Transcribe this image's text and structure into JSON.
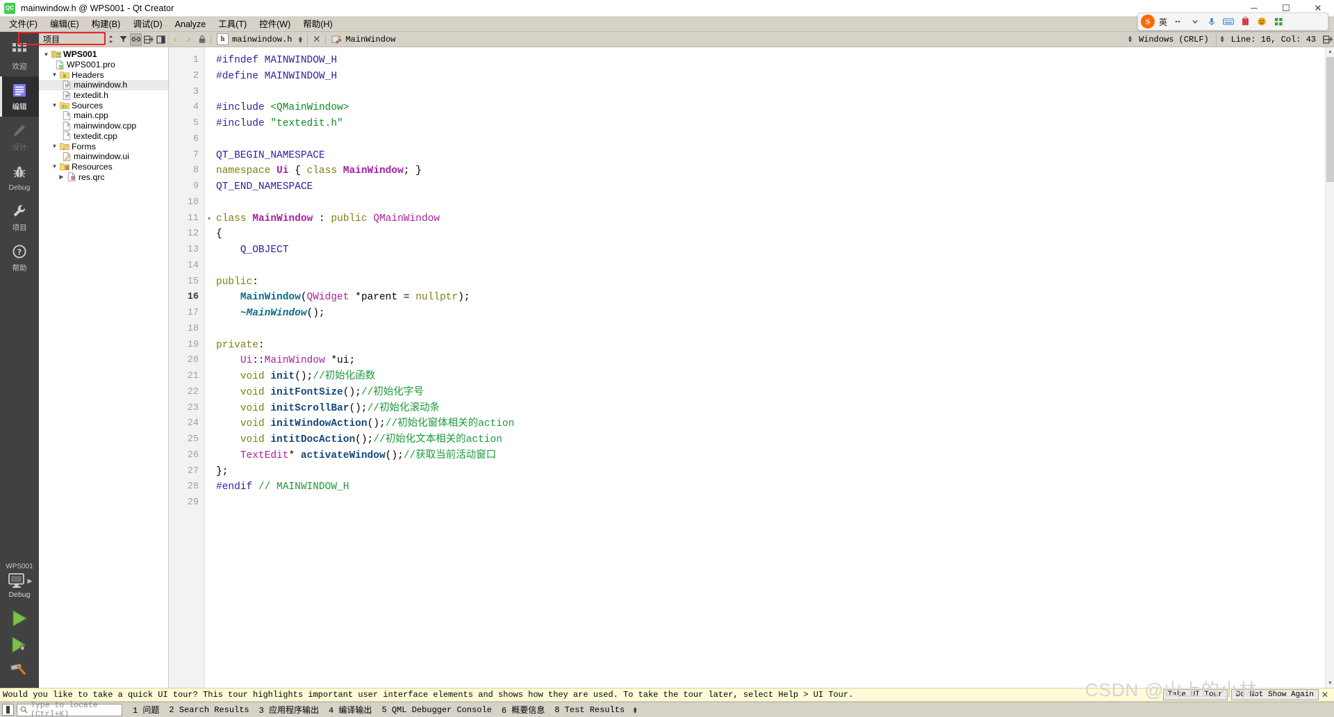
{
  "window": {
    "title": "mainwindow.h @ WPS001 - Qt Creator",
    "app_icon": "qt-creator-icon",
    "minimize": "─",
    "maximize": "☐",
    "close": "✕"
  },
  "menubar": {
    "items": [
      {
        "label": "文件(F)",
        "name": "menu-file"
      },
      {
        "label": "编辑(E)",
        "name": "menu-edit"
      },
      {
        "label": "构建(B)",
        "name": "menu-build"
      },
      {
        "label": "调试(D)",
        "name": "menu-debug"
      },
      {
        "label": "Analyze",
        "name": "menu-analyze"
      },
      {
        "label": "工具(T)",
        "name": "menu-tools"
      },
      {
        "label": "控件(W)",
        "name": "menu-window"
      },
      {
        "label": "帮助(H)",
        "name": "menu-help"
      }
    ]
  },
  "ime_toolbar": {
    "logo": "S",
    "mode_label": "英",
    "items": [
      "dots-icon",
      "chevron-down-icon",
      "microphone-icon",
      "keyboard-icon",
      "clipboard-icon",
      "emoji-icon",
      "grid-icon"
    ]
  },
  "modebar": {
    "items": [
      {
        "label": "欢迎",
        "icon": "grid-icon",
        "state": "normal",
        "name": "mode-welcome"
      },
      {
        "label": "编辑",
        "icon": "document-icon",
        "state": "active",
        "name": "mode-edit"
      },
      {
        "label": "设计",
        "icon": "pencil-icon",
        "state": "disabled",
        "name": "mode-design"
      },
      {
        "label": "Debug",
        "icon": "bug-icon",
        "state": "normal",
        "name": "mode-debug"
      },
      {
        "label": "项目",
        "icon": "wrench-icon",
        "state": "normal",
        "name": "mode-projects"
      },
      {
        "label": "帮助",
        "icon": "question-icon",
        "state": "normal",
        "name": "mode-help"
      }
    ],
    "kit": {
      "project": "WPS001",
      "build_config": "Debug",
      "icon": "computer-icon",
      "run_tooltip": "run-button",
      "debug_tooltip": "start-debugging-button",
      "build_tooltip": "build-button"
    }
  },
  "project_pane": {
    "title": "项目",
    "toolbar": [
      "sync-view-icon",
      "filter-icon",
      "link-icon",
      "split-icon",
      "close-split-icon"
    ],
    "tree": [
      {
        "depth": 0,
        "twisty": "▼",
        "icon": "qt-project-icon",
        "label": "WPS001",
        "bold": true,
        "name": "tree-item-project"
      },
      {
        "depth": 1,
        "twisty": "",
        "icon": "pro-file-icon",
        "label": "WPS001.pro",
        "bold": false,
        "name": "tree-item-pro-file"
      },
      {
        "depth": 1,
        "twisty": "▼",
        "icon": "headers-folder-icon",
        "label": "Headers",
        "bold": false,
        "name": "tree-item-headers"
      },
      {
        "depth": 2,
        "twisty": "",
        "icon": "h-file-icon",
        "label": "mainwindow.h",
        "bold": false,
        "selected": true,
        "highlight": true,
        "name": "tree-item-mainwindow-h"
      },
      {
        "depth": 2,
        "twisty": "",
        "icon": "h-file-icon",
        "label": "textedit.h",
        "bold": false,
        "name": "tree-item-textedit-h"
      },
      {
        "depth": 1,
        "twisty": "▼",
        "icon": "sources-folder-icon",
        "label": "Sources",
        "bold": false,
        "name": "tree-item-sources"
      },
      {
        "depth": 2,
        "twisty": "",
        "icon": "cpp-file-icon",
        "label": "main.cpp",
        "bold": false,
        "name": "tree-item-main-cpp"
      },
      {
        "depth": 2,
        "twisty": "",
        "icon": "cpp-file-icon",
        "label": "mainwindow.cpp",
        "bold": false,
        "name": "tree-item-mainwindow-cpp"
      },
      {
        "depth": 2,
        "twisty": "",
        "icon": "cpp-file-icon",
        "label": "textedit.cpp",
        "bold": false,
        "name": "tree-item-textedit-cpp"
      },
      {
        "depth": 1,
        "twisty": "▼",
        "icon": "forms-folder-icon",
        "label": "Forms",
        "bold": false,
        "name": "tree-item-forms"
      },
      {
        "depth": 2,
        "twisty": "",
        "icon": "ui-file-icon",
        "label": "mainwindow.ui",
        "bold": false,
        "name": "tree-item-mainwindow-ui"
      },
      {
        "depth": 1,
        "twisty": "▼",
        "icon": "resources-folder-icon",
        "label": "Resources",
        "bold": false,
        "name": "tree-item-resources"
      },
      {
        "depth": 2,
        "twisty": "▶",
        "icon": "qrc-file-icon",
        "label": "res.qrc",
        "bold": false,
        "name": "tree-item-res-qrc"
      }
    ]
  },
  "editor": {
    "toolbar": {
      "back": "‹",
      "forward": "›",
      "lock": "lock-icon",
      "file_badge": "h",
      "file_name": "mainwindow.h",
      "file_dropdown": "↕",
      "close": "✕",
      "symbol_icon": "class-icon",
      "symbol_name": "MainWindow"
    },
    "status": {
      "line_ending": "Windows (CRLF)",
      "cursor": "Line: 16, Col: 43",
      "split_icon": "split-editor-icon"
    },
    "current_line": 16,
    "total_lines": 29,
    "lines": [
      {
        "n": 1,
        "fold": "",
        "tokens": [
          {
            "t": "#ifndef MAINWINDOW_H",
            "c": "t-pp"
          }
        ]
      },
      {
        "n": 2,
        "fold": "",
        "tokens": [
          {
            "t": "#define MAINWINDOW_H",
            "c": "t-pp"
          }
        ]
      },
      {
        "n": 3,
        "fold": "",
        "tokens": []
      },
      {
        "n": 4,
        "fold": "",
        "tokens": [
          {
            "t": "#include ",
            "c": "t-pp"
          },
          {
            "t": "<QMainWindow>",
            "c": "t-str"
          }
        ]
      },
      {
        "n": 5,
        "fold": "",
        "tokens": [
          {
            "t": "#include ",
            "c": "t-pp"
          },
          {
            "t": "\"textedit.h\"",
            "c": "t-str"
          }
        ]
      },
      {
        "n": 6,
        "fold": "",
        "tokens": []
      },
      {
        "n": 7,
        "fold": "",
        "tokens": [
          {
            "t": "QT_BEGIN_NAMESPACE",
            "c": "t-pp"
          }
        ]
      },
      {
        "n": 8,
        "fold": "",
        "tokens": [
          {
            "t": "namespace ",
            "c": "t-kw"
          },
          {
            "t": "Ui",
            "c": "t-typeb"
          },
          {
            "t": " { ",
            "c": "t-pl"
          },
          {
            "t": "class ",
            "c": "t-kw"
          },
          {
            "t": "MainWindow",
            "c": "t-typeb"
          },
          {
            "t": "; }",
            "c": "t-pl"
          }
        ]
      },
      {
        "n": 9,
        "fold": "",
        "tokens": [
          {
            "t": "QT_END_NAMESPACE",
            "c": "t-pp"
          }
        ]
      },
      {
        "n": 10,
        "fold": "",
        "tokens": []
      },
      {
        "n": 11,
        "fold": "▾",
        "tokens": [
          {
            "t": "class ",
            "c": "t-kw"
          },
          {
            "t": "MainWindow",
            "c": "t-typeb"
          },
          {
            "t": " : ",
            "c": "t-pl"
          },
          {
            "t": "public ",
            "c": "t-kw"
          },
          {
            "t": "QMainWindow",
            "c": "t-type"
          }
        ]
      },
      {
        "n": 12,
        "fold": "",
        "tokens": [
          {
            "t": "{",
            "c": "t-pl"
          }
        ]
      },
      {
        "n": 13,
        "fold": "",
        "tokens": [
          {
            "t": "    Q_OBJECT",
            "c": "t-pp"
          }
        ]
      },
      {
        "n": 14,
        "fold": "",
        "tokens": []
      },
      {
        "n": 15,
        "fold": "",
        "tokens": [
          {
            "t": "public",
            "c": "t-kw"
          },
          {
            "t": ":",
            "c": "t-pl"
          }
        ]
      },
      {
        "n": 16,
        "fold": "",
        "tokens": [
          {
            "t": "    ",
            "c": "t-pl"
          },
          {
            "t": "MainWindow",
            "c": "t-fn"
          },
          {
            "t": "(",
            "c": "t-pl"
          },
          {
            "t": "QWidget",
            "c": "t-type"
          },
          {
            "t": " *parent = ",
            "c": "t-pl"
          },
          {
            "t": "nullptr",
            "c": "t-kw"
          },
          {
            "t": ");",
            "c": "t-pl"
          }
        ]
      },
      {
        "n": 17,
        "fold": "",
        "tokens": [
          {
            "t": "    ~",
            "c": "t-fni"
          },
          {
            "t": "MainWindow",
            "c": "t-fni"
          },
          {
            "t": "();",
            "c": "t-pl"
          }
        ]
      },
      {
        "n": 18,
        "fold": "",
        "tokens": []
      },
      {
        "n": 19,
        "fold": "",
        "tokens": [
          {
            "t": "private",
            "c": "t-kw"
          },
          {
            "t": ":",
            "c": "t-pl"
          }
        ]
      },
      {
        "n": 20,
        "fold": "",
        "tokens": [
          {
            "t": "    ",
            "c": "t-pl"
          },
          {
            "t": "Ui",
            "c": "t-type"
          },
          {
            "t": "::",
            "c": "t-pl"
          },
          {
            "t": "MainWindow",
            "c": "t-type"
          },
          {
            "t": " *ui;",
            "c": "t-pl"
          }
        ]
      },
      {
        "n": 21,
        "fold": "",
        "tokens": [
          {
            "t": "    ",
            "c": "t-pl"
          },
          {
            "t": "void ",
            "c": "t-kw"
          },
          {
            "t": "init",
            "c": "t-fnd"
          },
          {
            "t": "();",
            "c": "t-pl"
          },
          {
            "t": "//初始化函数",
            "c": "t-com"
          }
        ]
      },
      {
        "n": 22,
        "fold": "",
        "tokens": [
          {
            "t": "    ",
            "c": "t-pl"
          },
          {
            "t": "void ",
            "c": "t-kw"
          },
          {
            "t": "initFontSize",
            "c": "t-fnd"
          },
          {
            "t": "();",
            "c": "t-pl"
          },
          {
            "t": "//初始化字号",
            "c": "t-com"
          }
        ]
      },
      {
        "n": 23,
        "fold": "",
        "tokens": [
          {
            "t": "    ",
            "c": "t-pl"
          },
          {
            "t": "void ",
            "c": "t-kw"
          },
          {
            "t": "initScrollBar",
            "c": "t-fnd"
          },
          {
            "t": "();",
            "c": "t-pl"
          },
          {
            "t": "//初始化滚动条",
            "c": "t-com"
          }
        ]
      },
      {
        "n": 24,
        "fold": "",
        "tokens": [
          {
            "t": "    ",
            "c": "t-pl"
          },
          {
            "t": "void ",
            "c": "t-kw"
          },
          {
            "t": "initWindowAction",
            "c": "t-fnd"
          },
          {
            "t": "();",
            "c": "t-pl"
          },
          {
            "t": "//初始化窗体相关的action",
            "c": "t-com"
          }
        ]
      },
      {
        "n": 25,
        "fold": "",
        "tokens": [
          {
            "t": "    ",
            "c": "t-pl"
          },
          {
            "t": "void ",
            "c": "t-kw"
          },
          {
            "t": "intitDocAction",
            "c": "t-fnd"
          },
          {
            "t": "();",
            "c": "t-pl"
          },
          {
            "t": "//初始化文本相关的action",
            "c": "t-com"
          }
        ]
      },
      {
        "n": 26,
        "fold": "",
        "tokens": [
          {
            "t": "    ",
            "c": "t-pl"
          },
          {
            "t": "TextEdit",
            "c": "t-type"
          },
          {
            "t": "* ",
            "c": "t-pl"
          },
          {
            "t": "activateWindow",
            "c": "t-fnd"
          },
          {
            "t": "();",
            "c": "t-pl"
          },
          {
            "t": "//获取当前活动窗口",
            "c": "t-com"
          }
        ]
      },
      {
        "n": 27,
        "fold": "",
        "tokens": [
          {
            "t": "};",
            "c": "t-pl"
          }
        ]
      },
      {
        "n": 28,
        "fold": "",
        "tokens": [
          {
            "t": "#endif ",
            "c": "t-pp"
          },
          {
            "t": "// MAINWINDOW_H",
            "c": "t-com"
          }
        ]
      },
      {
        "n": 29,
        "fold": "",
        "tokens": []
      }
    ]
  },
  "infobar": {
    "message": "Would you like to take a quick UI tour? This tour highlights important user interface elements and shows how they are used. To take the tour later, select Help > UI Tour.",
    "primary_button": "Take UI Tour",
    "secondary_button": "Do Not Show Again",
    "close": "✕"
  },
  "statusbar": {
    "sidebar_toggle": "toggle-sidebar-icon",
    "locator_placeholder": "Type to locate (Ctrl+K)",
    "locator_value": "",
    "search_icon": "search-icon",
    "tabs": [
      {
        "label": "1 问题",
        "name": "output-tab-issues"
      },
      {
        "label": "2 Search Results",
        "name": "output-tab-search-results"
      },
      {
        "label": "3 应用程序输出",
        "name": "output-tab-application-output"
      },
      {
        "label": "4 编译输出",
        "name": "output-tab-compile-output"
      },
      {
        "label": "5 QML Debugger Console",
        "name": "output-tab-qml-debugger-console"
      },
      {
        "label": "6 概要信息",
        "name": "output-tab-general-messages"
      },
      {
        "label": "8 Test Results",
        "name": "output-tab-test-results"
      }
    ]
  },
  "watermark": "CSDN @山上的小林"
}
